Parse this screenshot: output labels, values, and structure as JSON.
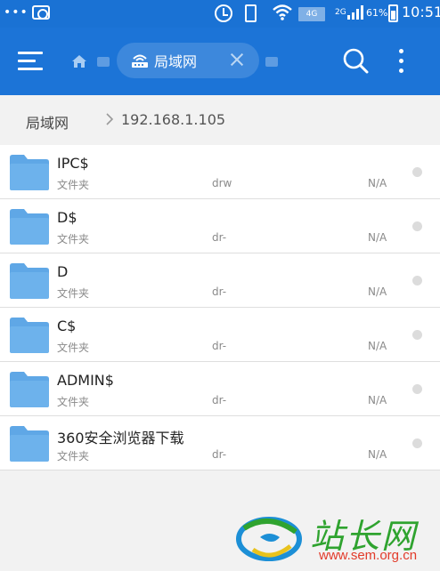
{
  "status_bar": {
    "dots": "•••",
    "network_badge": "4G",
    "secondary_network": "2G",
    "battery_percent": "61%",
    "time": "10:51",
    "icons": [
      "dots",
      "camera-icon",
      "alarm-icon",
      "phone-icon",
      "wifi-icon",
      "signal-icon",
      "battery-icon"
    ]
  },
  "app_bar": {
    "tab": {
      "label": "局域网",
      "icon": "lan-icon"
    },
    "icons": [
      "menu-icon",
      "home-icon",
      "search-icon",
      "more-icon"
    ]
  },
  "breadcrumb": {
    "root": "局域网",
    "current": "192.168.1.105"
  },
  "files": [
    {
      "name": "IPC$",
      "type": "文件夹",
      "permissions": "drw",
      "size": "N/A"
    },
    {
      "name": "D$",
      "type": "文件夹",
      "permissions": "dr-",
      "size": "N/A"
    },
    {
      "name": "D",
      "type": "文件夹",
      "permissions": "dr-",
      "size": "N/A"
    },
    {
      "name": "C$",
      "type": "文件夹",
      "permissions": "dr-",
      "size": "N/A"
    },
    {
      "name": "ADMIN$",
      "type": "文件夹",
      "permissions": "dr-",
      "size": "N/A"
    },
    {
      "name": "360安全浏览器下载",
      "type": "文件夹",
      "permissions": "dr-",
      "size": "N/A"
    }
  ],
  "watermark": {
    "title": "站长网",
    "url": "www.sem.org.cn"
  },
  "colors": {
    "primary": "#1c74d7",
    "status_bar": "#1a72d4",
    "tab_chip": "#3d88dc",
    "folder": "#5fa7e6",
    "background": "#f2f2f2",
    "watermark_green": "#2fa32f",
    "watermark_red": "#e23b2a"
  }
}
